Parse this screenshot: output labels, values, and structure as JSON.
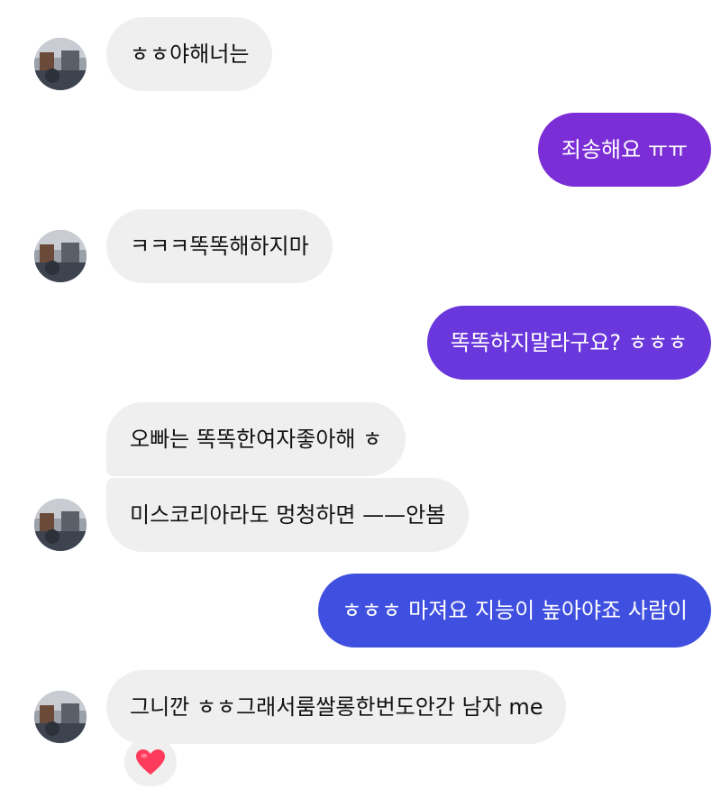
{
  "messages": [
    {
      "side": "in",
      "text": "ㅎㅎ야해너는"
    },
    {
      "side": "out",
      "text": "죄송해요 ㅠㅠ"
    },
    {
      "side": "in",
      "text": "ㅋㅋㅋ똑똑해하지마"
    },
    {
      "side": "out",
      "text": "똑똑하지말라구요? ㅎㅎㅎ"
    },
    {
      "side": "in",
      "text": "오빠는 똑똑한여자좋아해 ㅎ"
    },
    {
      "side": "in",
      "text": "미스코리아라도 멍청하면 ——안봄"
    },
    {
      "side": "out",
      "text": "ㅎㅎㅎ 마져요 지능이 높아야죠 사람이"
    },
    {
      "side": "in",
      "text": "그니깐 ㅎㅎ그래서룸쌀롱한번도안간 남자 me"
    }
  ],
  "reaction": {
    "icon": "heart-icon",
    "color": "#ff3b5c"
  },
  "colors": {
    "incoming_bubble": "#efefef",
    "outgoing_purple": "#7c2ed6",
    "outgoing_violet": "#6a37dc",
    "outgoing_blue": "#3f4fe0"
  }
}
